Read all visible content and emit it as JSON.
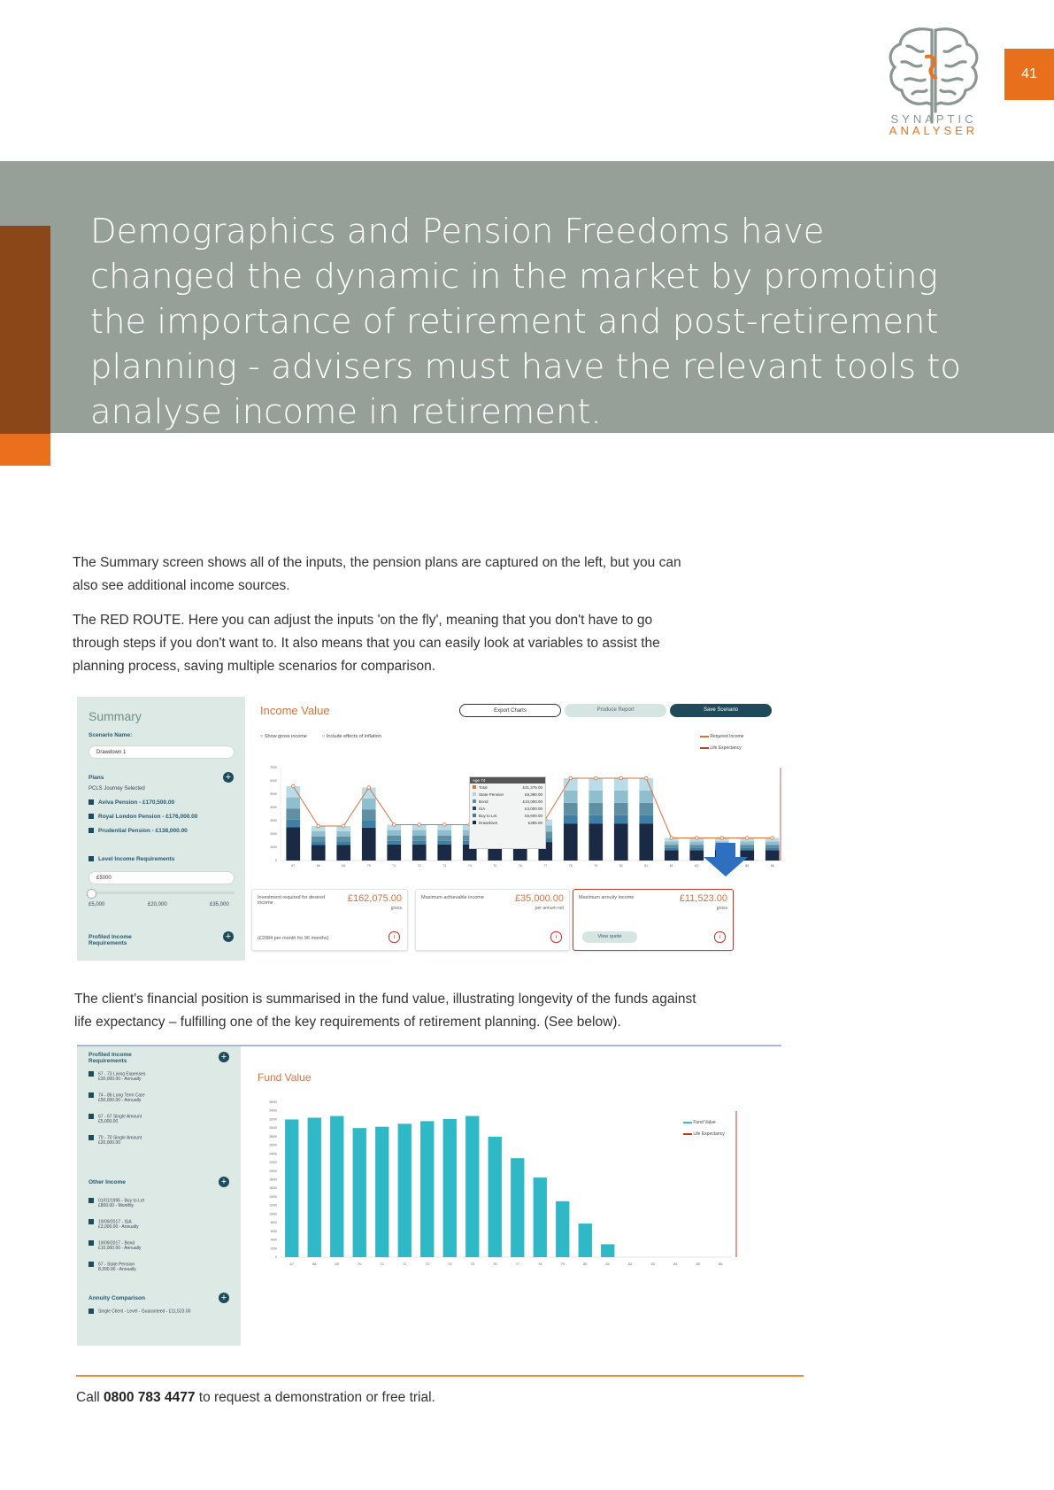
{
  "header": {
    "logo_name": "brain-logo",
    "brand_line1": "SYNAPTIC",
    "brand_line2": "ANALYSER",
    "page_number": "41",
    "accent_color": "#e86f1c",
    "banner_color": "#97a098"
  },
  "banner": {
    "headline": "Demographics and Pension Freedoms have changed the dynamic in the market by promoting the importance of retirement and post-retirement planning - advisers must have the relevant tools to analyse income in retirement."
  },
  "body": {
    "p1": "The Summary screen shows all of the inputs, the pension plans are captured on the left, but you can also see additional income sources.",
    "p2": "The RED ROUTE. Here you can adjust the inputs 'on the fly', meaning that you don't have to go through steps if you don't want to. It also means that you can easily look at variables to assist the planning process, saving multiple scenarios for comparison.",
    "p3": "The client's financial position is summarised in the fund value, illustrating longevity of the funds against life expectancy – fulfilling one of the key requirements of retirement planning. (See below)."
  },
  "shot1": {
    "sidebar": {
      "title": "Summary",
      "scenario_label": "Scenario Name:",
      "scenario_value": "Drawdown 1",
      "plans_label": "Plans",
      "journey": "PCLS Journey Selected",
      "plans": [
        "Aviva Pension - £170,500.00",
        "Royal London Pension - £176,000.00",
        "Prudential Pension - £138,000.00"
      ],
      "level_label": "Level Income Requirements",
      "level_value": "£5000",
      "slider_min": "£5,000",
      "slider_mid": "£20,000",
      "slider_max": "£35,000",
      "profiled_label": "Profiled Income Requirements"
    },
    "main": {
      "title": "Income Value",
      "btn_export": "Export Charts",
      "btn_report": "Produce Report",
      "btn_save": "Save Scenario",
      "opt_gross": "Show gross income",
      "opt_inflation": "Include effects of inflation",
      "legend_required": "Required Income",
      "legend_life": "Life Expectancy",
      "tooltip_title": "Age 74",
      "tooltip_rows": [
        {
          "label": "Total",
          "value": "£31,375.00"
        },
        {
          "label": "State Pension",
          "value": "£8,390.00"
        },
        {
          "label": "Bond",
          "value": "£10,000.00"
        },
        {
          "label": "ISA",
          "value": "£3,000.00"
        },
        {
          "label": "Buy to Let",
          "value": "£9,600.00"
        },
        {
          "label": "Drawdown",
          "value": "£385.00"
        }
      ],
      "card1_label": "Investment required for desired income",
      "card1_value": "£162,075.00",
      "card1_sub": "gross",
      "card1_note": "(£2084 per month for 96 months)",
      "card2_label": "Maximum achievable income",
      "card2_value": "£35,000.00",
      "card2_sub": "per annum net",
      "card3_label": "Maximum annuity income",
      "card3_value": "£11,523.00",
      "card3_sub": "gross",
      "card3_btn": "View quote"
    }
  },
  "shot2": {
    "sidebar": {
      "profiled_label": "Profiled Income Requirements",
      "profiled_items": [
        {
          "line1": "67 - 73 Living Expenses",
          "line2": "£30,000.00 - Annually"
        },
        {
          "line1": "74 - 86 Long Term Care",
          "line2": "£50,000.00 - Annually"
        },
        {
          "line1": "67 - 67 Single Amount",
          "line2": "£5,000.00"
        },
        {
          "line1": "70 - 70 Single Amount",
          "line2": "£20,000.00"
        }
      ],
      "other_label": "Other Income",
      "other_items": [
        {
          "line1": "01/01/1995 - Buy to Let",
          "line2": "£800.00 - Monthly"
        },
        {
          "line1": "19/09/2017 - ISA",
          "line2": "£3,000.00 - Annually"
        },
        {
          "line1": "19/09/2017 - Bond",
          "line2": "£10,000.00 - Annually"
        },
        {
          "line1": "67 - State Pension",
          "line2": "8,390.00 - Annually"
        }
      ],
      "annuity_label": "Annuity Comparison",
      "annuity_item": "Single Client - Level - Guaranteed - £11,523.00"
    },
    "main": {
      "title": "Fund Value",
      "legend_fund": "Fund Value",
      "legend_life": "Life Expectancy"
    }
  },
  "footer": {
    "prefix": "Call",
    "phone": "0800 783 4477",
    "suffix": "to request a demonstration or free trial."
  },
  "chart_data": [
    {
      "type": "bar",
      "title": "Income Value",
      "categories": [
        "67",
        "68",
        "69",
        "70",
        "71",
        "72",
        "73",
        "74",
        "75",
        "76",
        "77",
        "78",
        "79",
        "80",
        "81",
        "82",
        "83",
        "84",
        "85",
        "86"
      ],
      "values": [
        5600,
        2600,
        2600,
        5500,
        2700,
        2700,
        2700,
        2700,
        3100,
        3100,
        3100,
        6200,
        6200,
        6200,
        6200,
        1700,
        1700,
        1700,
        1700,
        1700
      ],
      "series": [
        {
          "name": "Required Income",
          "values": [
            5600,
            2600,
            2600,
            5500,
            2700,
            2700,
            2700,
            2700,
            3100,
            3100,
            3100,
            6200,
            6200,
            6200,
            6200,
            1700,
            1700,
            1700,
            1700,
            1700
          ]
        }
      ],
      "ylim": [
        0,
        7000
      ]
    },
    {
      "type": "bar",
      "title": "Fund Value",
      "categories": [
        "67",
        "68",
        "69",
        "70",
        "71",
        "72",
        "73",
        "74",
        "75",
        "76",
        "77",
        "78",
        "79",
        "80",
        "81",
        "82",
        "83",
        "84",
        "85",
        "86"
      ],
      "values": [
        32000,
        32400,
        32800,
        30000,
        30300,
        31000,
        31600,
        32100,
        32800,
        28000,
        23000,
        18500,
        13000,
        7800,
        3000,
        0,
        0,
        0,
        0,
        0
      ],
      "ylim": [
        0,
        36000
      ]
    }
  ]
}
